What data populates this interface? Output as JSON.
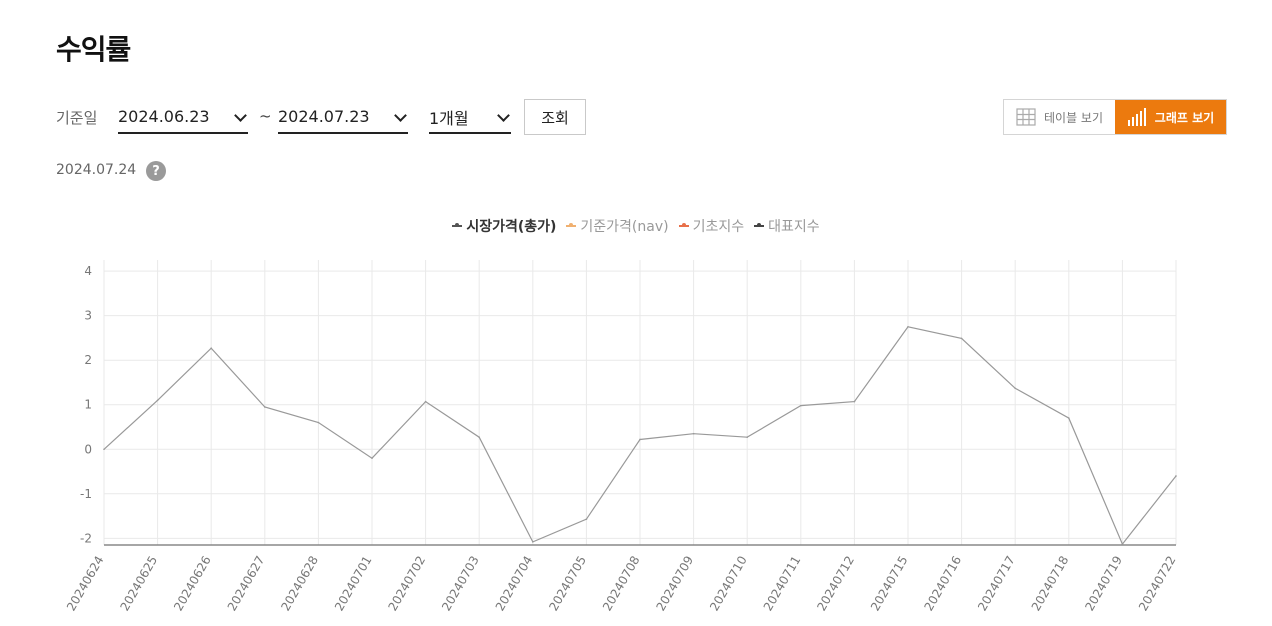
{
  "page": {
    "title": "수익률"
  },
  "filter": {
    "label": "기준일",
    "start_date": "2024.06.23",
    "separator": "~",
    "end_date": "2024.07.23",
    "period": "1개월",
    "search_label": "조회"
  },
  "view_toggle": {
    "table_label": "테이블 보기",
    "graph_label": "그래프 보기",
    "selected": "graph"
  },
  "info": {
    "date": "2024.07.24",
    "help": "?"
  },
  "colors": {
    "accent": "#ec7a0e",
    "line": "#999999",
    "grid": "#e9e9e9"
  },
  "chart_data": {
    "type": "line",
    "legend": [
      {
        "name": "시장가격(총가)",
        "color": "#555555",
        "active": true
      },
      {
        "name": "기준가격(nav)",
        "color": "#f0b070",
        "active": false
      },
      {
        "name": "기초지수",
        "color": "#e8704a",
        "active": false
      },
      {
        "name": "대표지수",
        "color": "#444444",
        "active": false
      }
    ],
    "x": [
      "20240624",
      "20240625",
      "20240626",
      "20240627",
      "20240628",
      "20240701",
      "20240702",
      "20240703",
      "20240704",
      "20240705",
      "20240708",
      "20240709",
      "20240710",
      "20240711",
      "20240712",
      "20240715",
      "20240716",
      "20240717",
      "20240718",
      "20240719",
      "20240722"
    ],
    "series": [
      {
        "name": "시장가격(총가)",
        "values": [
          0.0,
          1.1,
          2.27,
          0.95,
          0.6,
          -0.2,
          1.07,
          0.27,
          -2.08,
          -1.57,
          0.22,
          0.35,
          0.27,
          0.98,
          1.07,
          2.75,
          2.49,
          1.37,
          0.7,
          -2.13,
          -0.6
        ]
      }
    ],
    "yticks": [
      4,
      3,
      2,
      1,
      0,
      -1,
      -2
    ],
    "ylim": [
      -2.15,
      4.25
    ],
    "grid": true,
    "legend_position": "top-center"
  }
}
